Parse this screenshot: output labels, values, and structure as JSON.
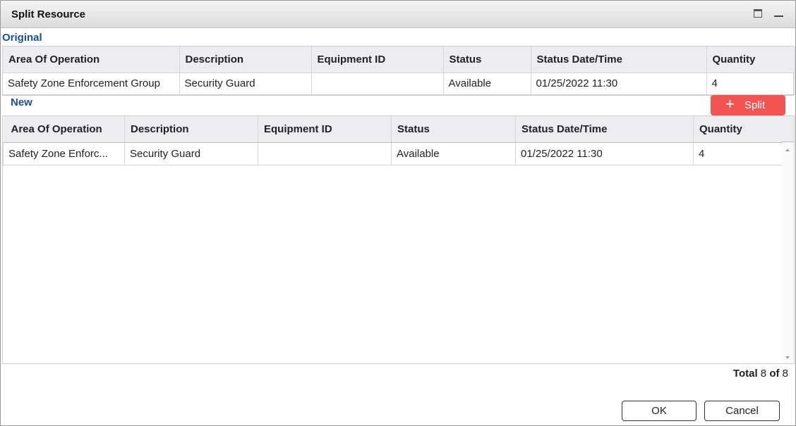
{
  "window": {
    "title": "Split Resource"
  },
  "original": {
    "label": "Original",
    "columns": [
      "Area Of Operation",
      "Description",
      "Equipment ID",
      "Status",
      "Status Date/Time",
      "Quantity"
    ],
    "row": [
      "Safety Zone Enforcement Group",
      "Security Guard",
      "",
      "Available",
      "01/25/2022 11:30",
      "4"
    ]
  },
  "new": {
    "label": "New",
    "split_label": "Split",
    "columns": [
      "Area Of Operation",
      "Description",
      "Equipment ID",
      "Status",
      "Status Date/Time",
      "Quantity"
    ],
    "rows": [
      [
        "Safety Zone Enforc...",
        "Security Guard",
        "",
        "Available",
        "01/25/2022 11:30",
        "4"
      ]
    ]
  },
  "footer": {
    "total_label": "Total",
    "shown": "8",
    "of_label": "of",
    "total": "8",
    "ok_label": "OK",
    "cancel_label": "Cancel"
  },
  "icons": {
    "maximize": "maximize-icon",
    "minimize": "minimize-icon",
    "split": "plus-icon"
  },
  "colors": {
    "section_label": "#1d4f91",
    "split_button": "#f25353",
    "header_bg": "#ededf0"
  }
}
